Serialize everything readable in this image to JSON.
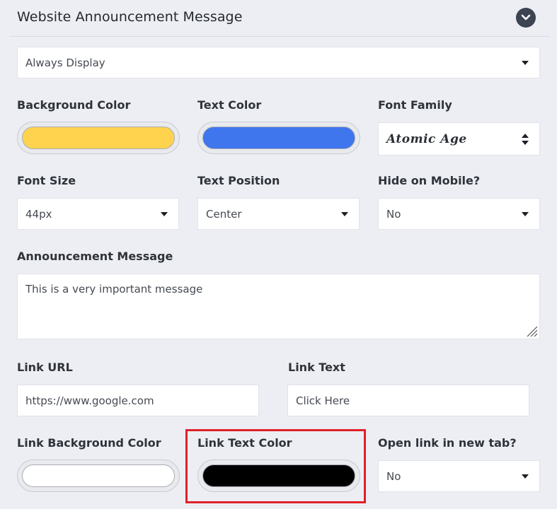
{
  "header": {
    "title": "Website Announcement Message",
    "collapse_icon": "chevron-down-icon"
  },
  "display_mode": {
    "value": "Always Display"
  },
  "background_color": {
    "label": "Background Color",
    "value": "#ffd34d"
  },
  "text_color": {
    "label": "Text Color",
    "value": "#3f76ee"
  },
  "font_family": {
    "label": "Font Family",
    "value": "Atomic Age"
  },
  "font_size": {
    "label": "Font Size",
    "value": "44px"
  },
  "text_position": {
    "label": "Text Position",
    "value": "Center"
  },
  "hide_on_mobile": {
    "label": "Hide on Mobile?",
    "value": "No"
  },
  "announcement_message": {
    "label": "Announcement Message",
    "value": "This is a very important message"
  },
  "link_url": {
    "label": "Link URL",
    "value": "https://www.google.com"
  },
  "link_text": {
    "label": "Link Text",
    "value": "Click Here"
  },
  "link_background_color": {
    "label": "Link Background Color",
    "value": "#ffffff"
  },
  "link_text_color": {
    "label": "Link Text Color",
    "value": "#000000"
  },
  "open_link_new_tab": {
    "label": "Open link in new tab?",
    "value": "No"
  },
  "highlight_color": "#e0202a"
}
